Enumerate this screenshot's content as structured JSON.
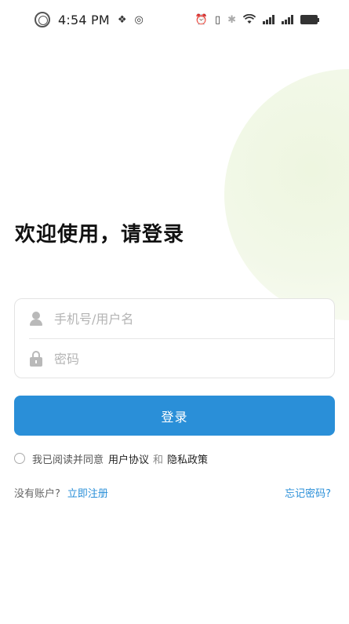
{
  "status_bar": {
    "time": "4:54 PM",
    "icons": [
      "settings-circle-icon",
      "network-logo-icon",
      "network-logo-icon-2",
      "alarm-icon",
      "vibrate-icon",
      "bluetooth-icon",
      "wifi-icon",
      "signal-icon",
      "signal-icon-2",
      "battery-icon"
    ]
  },
  "welcome": {
    "title": "欢迎使用，请登录"
  },
  "form": {
    "username_placeholder": "手机号/用户名",
    "username_value": "",
    "password_placeholder": "密码",
    "password_value": ""
  },
  "login_button": {
    "label": "登录"
  },
  "agreement": {
    "prefix": "我已阅读并同意",
    "user_agreement": "用户协议",
    "and": "和",
    "privacy_policy": "隐私政策",
    "checked": false
  },
  "footer": {
    "no_account": "没有账户?",
    "register": "立即注册",
    "forgot_password": "忘记密码?"
  },
  "colors": {
    "accent": "#2a8fd8",
    "decor_circle": "#eef6e0"
  }
}
